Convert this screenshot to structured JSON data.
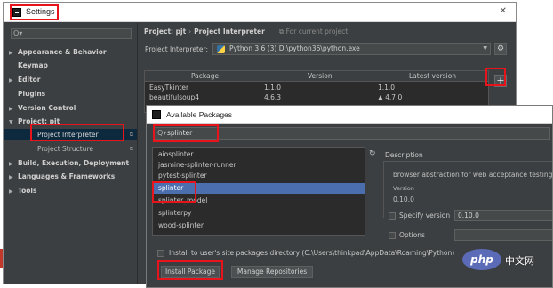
{
  "settings_window": {
    "title": "Settings",
    "close_glyph": "✕",
    "search_glyph": "Q▾"
  },
  "sidebar": {
    "items": [
      {
        "label": "Appearance & Behavior",
        "expandable": true
      },
      {
        "label": "Keymap",
        "expandable": false
      },
      {
        "label": "Editor",
        "expandable": true
      },
      {
        "label": "Plugins",
        "expandable": false
      },
      {
        "label": "Version Control",
        "expandable": true
      },
      {
        "label": "Project: pjt",
        "expandable": true,
        "expanded": true
      },
      {
        "label": "Project Interpreter",
        "child": true,
        "selected": true
      },
      {
        "label": "Project Structure",
        "child": true
      },
      {
        "label": "Build, Execution, Deployment",
        "expandable": true
      },
      {
        "label": "Languages & Frameworks",
        "expandable": true
      },
      {
        "label": "Tools",
        "expandable": true
      }
    ]
  },
  "header": {
    "breadcrumb_project": "Project: pjt",
    "breadcrumb_sep": "›",
    "breadcrumb_page": "Project Interpreter",
    "for_current": "For current project"
  },
  "interpreter": {
    "label": "Project Interpreter:",
    "value": "Python 3.6 (3) D:\\python36\\python.exe"
  },
  "packages_table": {
    "columns": [
      "Package",
      "Version",
      "Latest version"
    ],
    "rows": [
      {
        "package": "EasyTkinter",
        "version": "1.1.0",
        "latest": "1.1.0"
      },
      {
        "package": "beautifulsoup4",
        "version": "4.6.3",
        "latest": "▲ 4.7.0"
      }
    ],
    "add_glyph": "+",
    "gear_glyph": "⚙"
  },
  "dialog": {
    "title": "Available Packages",
    "search_value": "splinter",
    "list": [
      {
        "name": "aiosplinter"
      },
      {
        "name": "jasmine-splinter-runner"
      },
      {
        "name": "pytest-splinter"
      },
      {
        "name": "splinter",
        "selected": true
      },
      {
        "name": "splinter_model"
      },
      {
        "name": "splinterpy"
      },
      {
        "name": "wood-splinter"
      }
    ],
    "refresh_glyph": "↻",
    "description_label": "Description",
    "description_text": "browser abstraction for web acceptance testing",
    "version_label": "Version",
    "version_value": "0.10.0",
    "specify_version_label": "Specify version",
    "specify_version_value": "0.10.0",
    "options_label": "Options",
    "install_site_label": "Install to user's site packages directory (C:\\Users\\thinkpad\\AppData\\Roaming\\Python)",
    "install_button": "Install Package",
    "manage_button": "Manage Repositories"
  },
  "watermark": {
    "logo": "php",
    "text": "中文网"
  },
  "colors": {
    "ide_bg": "#3c3f41",
    "selection": "#4b6eaf",
    "highlight_red": "#e8141c",
    "php_purple": "#5c6bb8"
  }
}
